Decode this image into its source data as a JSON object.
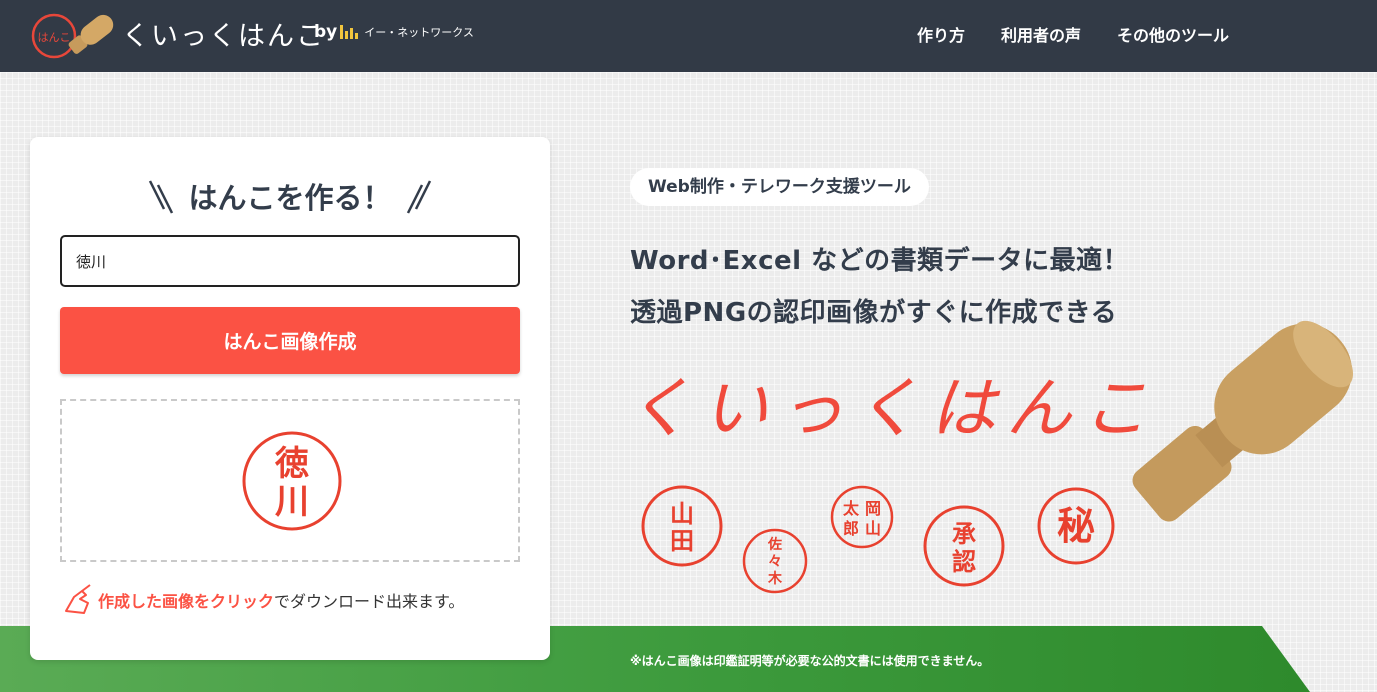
{
  "header": {
    "logo_text": "くいっくはんこ",
    "logo_seal_text": "はんこ",
    "by_label": "by",
    "company": "イー・ネットワークス",
    "nav": [
      "作り方",
      "利用者の声",
      "その他のツール"
    ]
  },
  "form": {
    "title": "はんこを作る！",
    "input_value": "徳川",
    "button_label": "はんこ画像作成",
    "preview_stamp_chars": [
      "徳",
      "川"
    ],
    "hint_highlight": "作成した画像をクリック",
    "hint_rest": "でダウンロード出来ます。"
  },
  "hero": {
    "pill": "Web制作・テレワーク支援ツール",
    "headline1": "Word･Excel などの書類データに最適！",
    "headline2": "透過PNGの認印画像がすぐに作成できる",
    "logo": "くいっくはんこ",
    "sample_seals": [
      [
        "山",
        "田"
      ],
      [
        "佐",
        "々",
        "木"
      ],
      [
        "太",
        "郎",
        "岡",
        "山"
      ],
      [
        "承",
        "認"
      ],
      [
        "秘"
      ]
    ]
  },
  "footer_note": "※はんこ画像は印鑑証明等が必要な公的文書には使用できません。",
  "colors": {
    "header_bg": "#323a46",
    "accent_red": "#fb5244",
    "band_green": "#3c9a3c",
    "text_dark": "#333d4b"
  },
  "icons": [
    "hanko-logo-icon",
    "company-bars-icon",
    "pointing-hand-icon",
    "hanko-stamp-icon"
  ]
}
